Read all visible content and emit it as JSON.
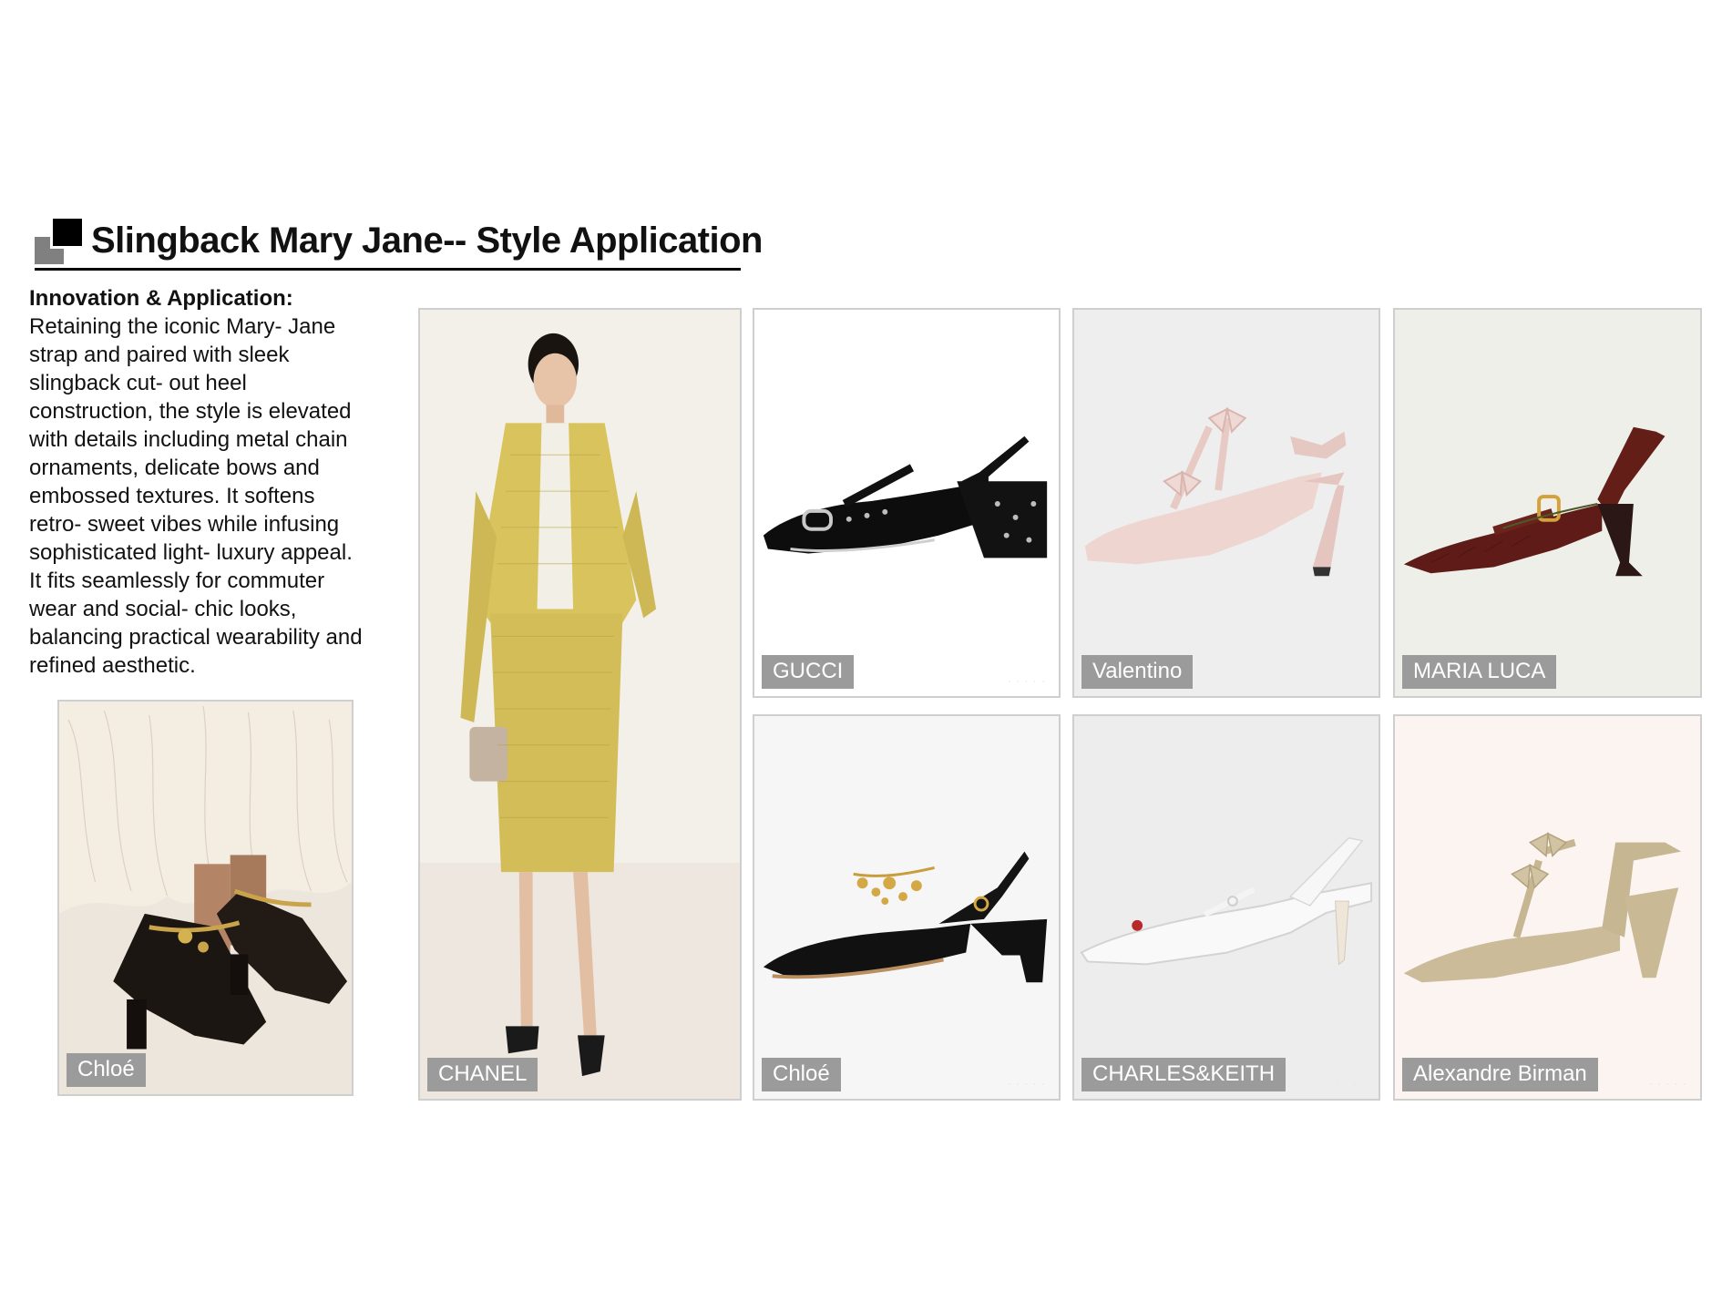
{
  "header": {
    "title": "Slingback Mary Jane-- Style Application"
  },
  "description": {
    "heading": "Innovation & Application:",
    "body": "Retaining the iconic Mary-  Jane\nstrap and paired with sleek\nslingback cut-  out heel\nconstruction, the style is elevated\nwith details including metal chain\nornaments, delicate bows and\nembossed textures. It softens\nretro-  sweet vibes while infusing\nsophisticated light-  luxury appeal.\nIt fits seamlessly for commuter\nwear and social-  chic looks,\nbalancing practical wearability and\nrefined aesthetic."
  },
  "cards": [
    {
      "id": "chloe-worn",
      "brand": "Chloé",
      "image": "shoe-on-feet-photo"
    },
    {
      "id": "chanel-look",
      "brand": "CHANEL",
      "image": "runway-look-photo"
    },
    {
      "id": "gucci",
      "brand": "GUCCI",
      "image": "black-patent-slingback"
    },
    {
      "id": "valentino",
      "brand": "Valentino",
      "image": "pink-bow-slingback"
    },
    {
      "id": "maria-luca",
      "brand": "MARIA LUCA",
      "image": "burgundy-croc-slingback"
    },
    {
      "id": "chloe-product",
      "brand": "Chloé",
      "image": "black-charm-slingback"
    },
    {
      "id": "charles-keith",
      "brand": "CHARLES&KEITH",
      "image": "white-slingback"
    },
    {
      "id": "alexandre-birman",
      "brand": "Alexandre Birman",
      "image": "beige-bow-slingback"
    }
  ],
  "colors": {
    "tag_background": "#9b9b9b",
    "card_border": "#cfcfcf",
    "title_rule": "#000000"
  }
}
